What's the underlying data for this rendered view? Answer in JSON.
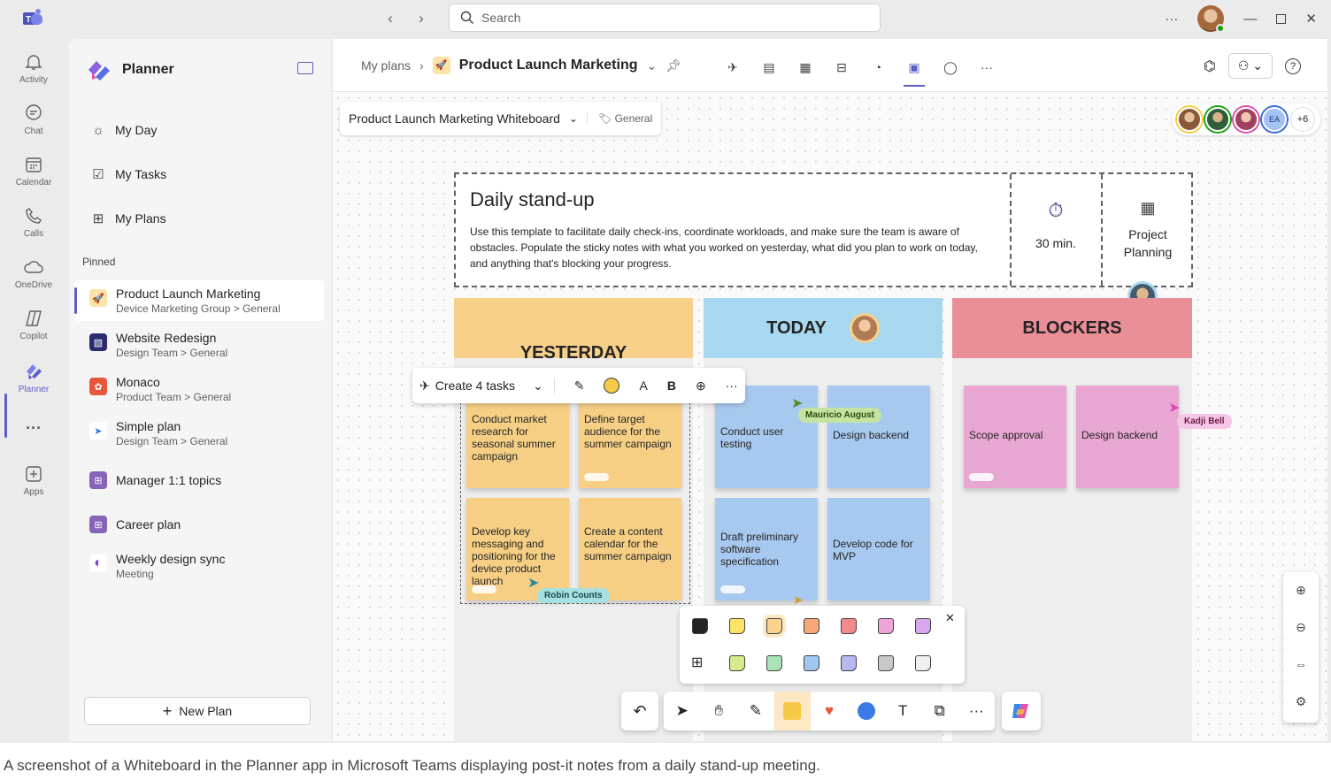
{
  "titlebar": {
    "search_placeholder": "Search",
    "more": "···"
  },
  "rail": {
    "items": [
      {
        "label": "Activity",
        "icon": "bell-icon"
      },
      {
        "label": "Chat",
        "icon": "chat-icon"
      },
      {
        "label": "Calendar",
        "icon": "calendar-icon"
      },
      {
        "label": "Calls",
        "icon": "phone-icon"
      },
      {
        "label": "OneDrive",
        "icon": "cloud-icon"
      },
      {
        "label": "Copilot",
        "icon": "copilot-icon"
      },
      {
        "label": "Planner",
        "icon": "planner-icon"
      },
      {
        "label": "···",
        "icon": "more-icon"
      },
      {
        "label": "Apps",
        "icon": "apps-icon"
      }
    ]
  },
  "sidebar": {
    "title": "Planner",
    "nav": [
      {
        "label": "My Day"
      },
      {
        "label": "My Tasks"
      },
      {
        "label": "My Plans"
      }
    ],
    "pinned_label": "Pinned",
    "plans": [
      {
        "name": "Product Launch Marketing",
        "sub": "Device Marketing Group > General",
        "color": "#ffb900"
      },
      {
        "name": "Website Redesign",
        "sub": "Design Team > General",
        "color": "#2b2b6e"
      },
      {
        "name": "Monaco",
        "sub": "Product Team > General",
        "color": "#e8573a"
      },
      {
        "name": "Simple plan",
        "sub": "Design Team > General",
        "color": "#3a6fd8"
      },
      {
        "name": "Manager 1:1 topics",
        "sub": "",
        "color": "#8764b8"
      },
      {
        "name": "Career plan",
        "sub": "",
        "color": "#8764b8"
      },
      {
        "name": "Weekly design sync",
        "sub": "Meeting",
        "color": "#7b3fe4"
      }
    ],
    "new_plan": "New Plan"
  },
  "header": {
    "breadcrumb_root": "My plans",
    "plan_title": "Product Launch Marketing"
  },
  "canvas": {
    "wb_title": "Product Launch Marketing Whiteboard",
    "wb_channel": "General",
    "collab_more": "+6",
    "collab_initials": "EA",
    "standup": {
      "title": "Daily stand-up",
      "desc": "Use this template to facilitate daily check-ins, coordinate workloads, and make sure the team is aware of obstacles.  Populate the sticky notes with what you worked on yesterday, what did you plan to work on today, and anything that's blocking your progress.",
      "duration": "30 min.",
      "project": "Project Planning"
    },
    "columns": {
      "yesterday": "YESTERDAY",
      "today": "TODAY",
      "blockers": "BLOCKERS"
    },
    "notes": {
      "y1": "Conduct market research for seasonal summer campaign",
      "y2": "Define target audience for the summer campaign",
      "y3": "Develop key messaging and positioning for the device product launch",
      "y4": "Create a content calendar for the summer campaign",
      "t1": "Conduct user testing",
      "t2": "Design backend",
      "t3": "Draft preliminary software specification",
      "t4": "Develop code for MVP",
      "b1": "Scope approval",
      "b2": "Design backend"
    },
    "cursors": {
      "mauricio": "Mauricio August",
      "robin": "Robin Counts",
      "kadji": "Kadji Bell"
    },
    "float_toolbar": {
      "create_tasks": "Create 4 tasks"
    }
  },
  "colors": {
    "accent": "#5b5fc7",
    "yesterday_header": "#f7d08a",
    "today_header": "#a8d8f0",
    "blockers_header": "#ea8f97"
  },
  "caption": "A screenshot of a Whiteboard in the Planner app in Microsoft Teams displaying post-it notes from a daily stand-up meeting."
}
